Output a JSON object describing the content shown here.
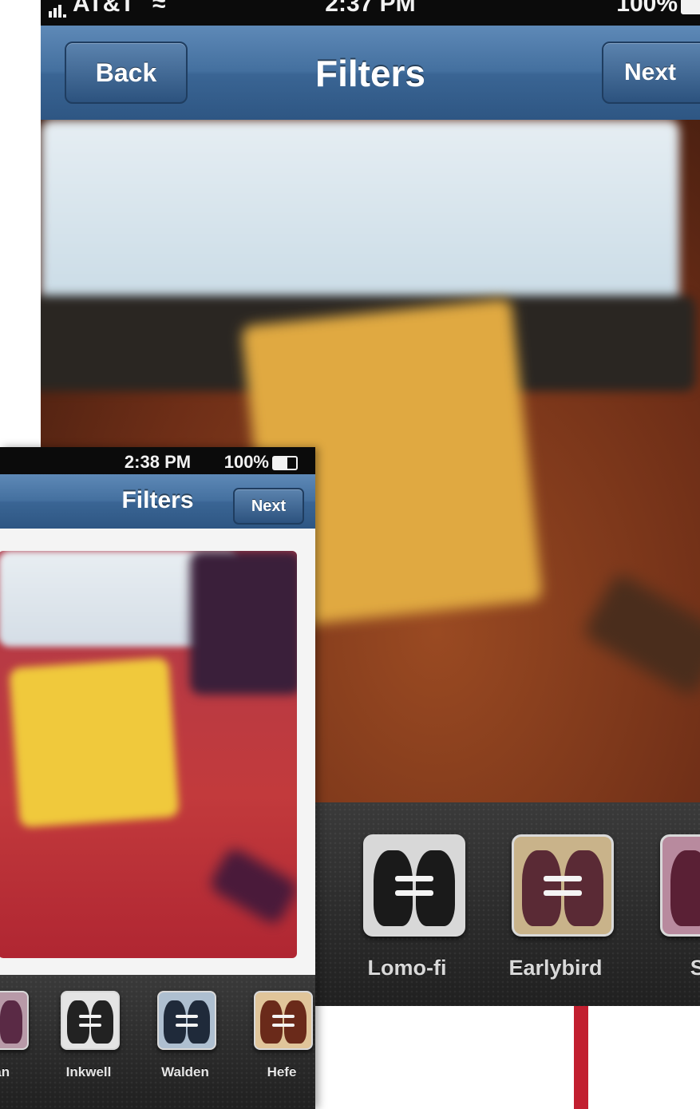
{
  "back_screen": {
    "status": {
      "carrier": "AT&T",
      "time": "2:37 PM",
      "battery": "100%"
    },
    "nav": {
      "back_label": "Back",
      "title": "Filters",
      "next_label": "Next"
    },
    "filters": [
      {
        "label": "Lomo-fi",
        "tint": "#d8d8d8"
      },
      {
        "label": "Earlybird",
        "tint": "#c9b38a"
      },
      {
        "label": "Su",
        "tint": "#b88a9e"
      }
    ]
  },
  "front_screen": {
    "status": {
      "time": "2:38 PM",
      "battery": "100%"
    },
    "nav": {
      "title": "Filters",
      "next_label": "Next"
    },
    "filters": [
      {
        "label": "nan",
        "tint": "#b89aa8"
      },
      {
        "label": "Inkwell",
        "tint": "#e4e4e4"
      },
      {
        "label": "Walden",
        "tint": "#aebfd0"
      },
      {
        "label": "Hefe",
        "tint": "#e0c59a"
      }
    ]
  },
  "colors": {
    "nav_blue": "#3a6594",
    "accent_red": "#c21f30",
    "strip_dark": "#2a2a2a"
  }
}
